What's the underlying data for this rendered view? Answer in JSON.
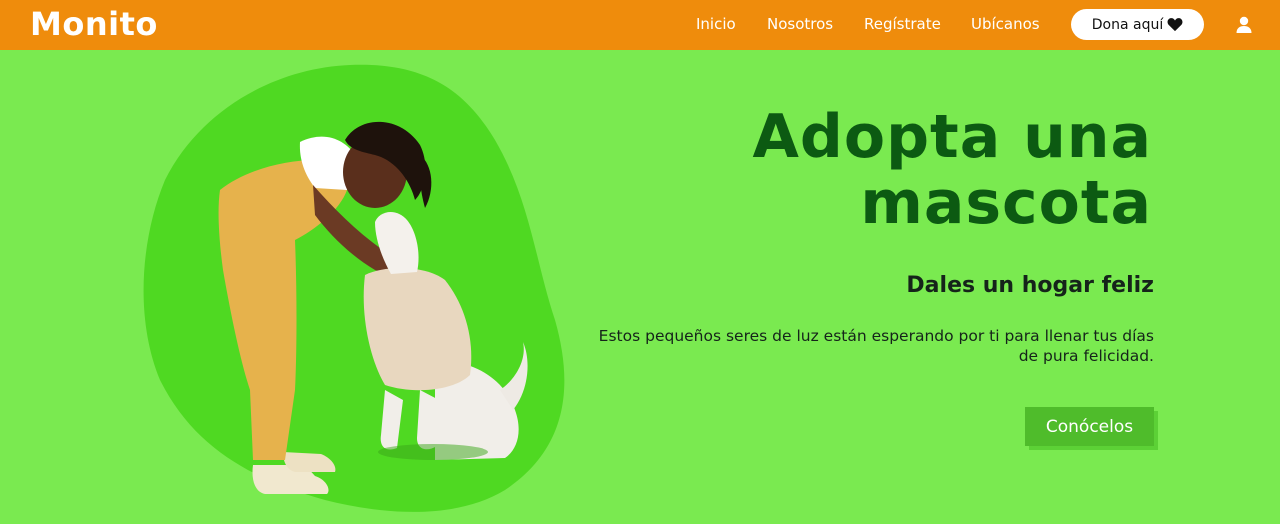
{
  "header": {
    "logo": "Monito",
    "nav": [
      {
        "label": "Inicio"
      },
      {
        "label": "Nosotros"
      },
      {
        "label": "Regístrate"
      },
      {
        "label": "Ubícanos"
      }
    ],
    "donate_label": "Dona aquí",
    "donate_icon": "heart-icon",
    "user_icon": "user-icon"
  },
  "hero": {
    "title": "Adopta una mascota",
    "subtitle": "Dales un hogar feliz",
    "text": "Estos pequeños seres de luz están esperando por ti para llenar tus días de pura felicidad.",
    "cta_label": "Conócelos",
    "illustration": "girl-hugging-dog-illustration"
  },
  "colors": {
    "navbar": "#ef8c0c",
    "background": "#7aea50",
    "blob": "#4fd922",
    "title": "#0c5a12",
    "cta": "#4fbc2b"
  }
}
